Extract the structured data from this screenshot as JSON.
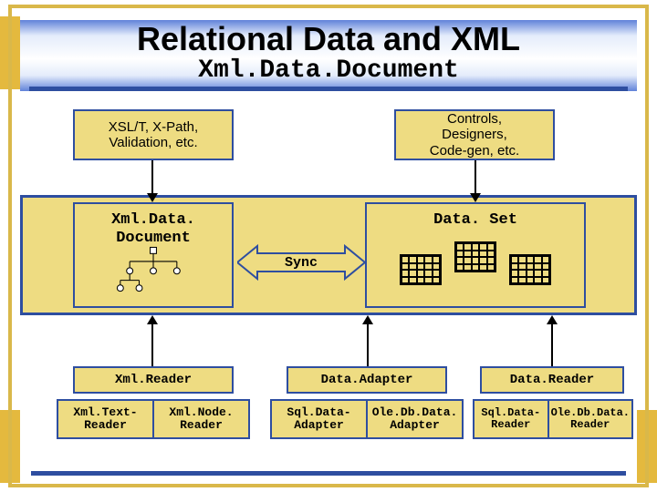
{
  "title": "Relational Data and XML",
  "subtitle": "Xml.Data.Document",
  "top": {
    "xsl": "XSL/T, X-Path,\nValidation, etc.",
    "controls": "Controls,\nDesigners,\nCode-gen, etc."
  },
  "mid": {
    "xml_data_document": "Xml.Data.\nDocument",
    "dataset": "Data. Set",
    "sync": "Sync"
  },
  "row3": {
    "xml_reader": "Xml.Reader",
    "data_adapter": "Data.Adapter",
    "data_reader": "Data.Reader"
  },
  "pairs": {
    "a1": "Xml.Text-\nReader",
    "a2": "Xml.Node.\nReader",
    "b1": "Sql.Data-\nAdapter",
    "b2": "Ole.Db.Data.\nAdapter",
    "c1": "Sql.Data-\nReader",
    "c2": "Ole.Db.Data.\nReader"
  }
}
